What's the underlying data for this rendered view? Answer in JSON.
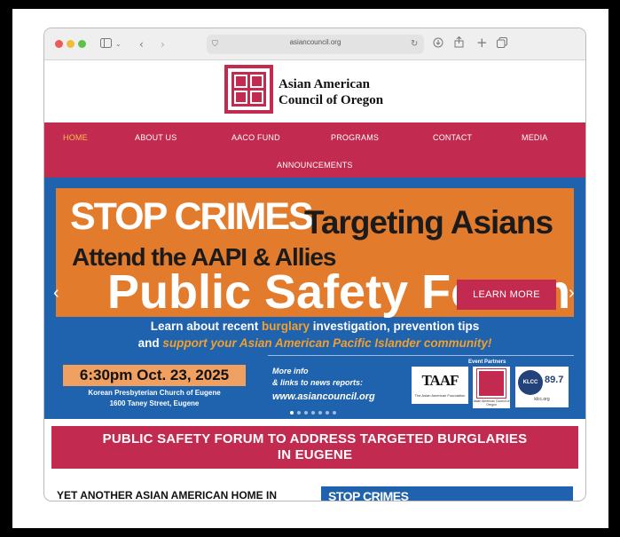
{
  "browser": {
    "url": "asiancouncil.org",
    "icons": [
      "sidebar-icon",
      "chevron-down-icon",
      "back-icon",
      "forward-icon",
      "shield-icon",
      "reload-icon",
      "download-icon",
      "share-icon",
      "new-tab-icon",
      "tabs-overview-icon"
    ]
  },
  "site": {
    "org_line1": "Asian American",
    "org_line2": "Council of Oregon",
    "brand_color": "#c32a50"
  },
  "nav": {
    "items": [
      "HOME",
      "ABOUT US",
      "AACO FUND",
      "PROGRAMS",
      "CONTACT",
      "MEDIA",
      "ANNOUNCEMENTS"
    ],
    "active": "HOME"
  },
  "banner": {
    "line_stop": "STOP CRIMES",
    "line_targeting": "Targeting Asians",
    "line_attend": "Attend the AAPI & Allies",
    "line_forum": "Public Safety Forum",
    "learn_more": "LEARN MORE",
    "learn_a": "Learn about recent ",
    "learn_b": "burglary",
    "learn_c": " investigation, prevention tips",
    "learn_d": "and ",
    "learn_e": "support your Asian American Pacific Islander community!",
    "date": "6:30pm Oct. 23, 2025",
    "venue": "Korean Presbyterian Church of Eugene",
    "address": "1600 Taney Street, Eugene",
    "more_info": "More info",
    "links_to": "& links to news reports:",
    "website": "www.asiancouncil.org",
    "partners_label": "Event Partners",
    "taaf": "TAAF",
    "taaf_sub": "The Asian American Foundation",
    "aaco_sub": "Asian American Council of Oregon",
    "klcc_logo": "KLCC",
    "klcc_freq": "89.7",
    "klcc_url": "klcc.org",
    "slides": 7,
    "active_slide": 1,
    "blue": "#1f62ae",
    "orange": "#e37b2d"
  },
  "headline": {
    "line1": "PUBLIC SAFETY FORUM TO ADDRESS TARGETED BURGLARIES",
    "line2": "IN EUGENE"
  },
  "teaser": {
    "text": "YET ANOTHER ASIAN AMERICAN HOME IN",
    "thumb_text": "STOP CRIMES"
  }
}
